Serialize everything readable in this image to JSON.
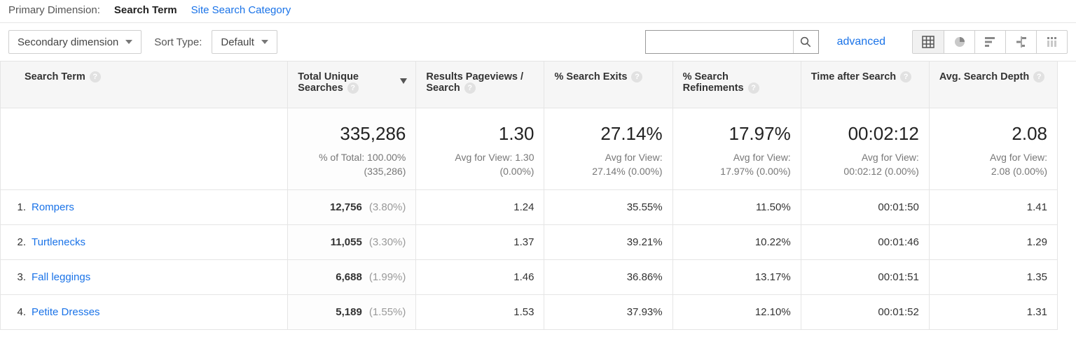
{
  "primary_dimension": {
    "label": "Primary Dimension:",
    "active": "Search Term",
    "other": "Site Search Category"
  },
  "toolbar": {
    "secondary_dimension": "Secondary dimension",
    "sort_type_label": "Sort Type:",
    "sort_type_value": "Default",
    "advanced": "advanced"
  },
  "columns": {
    "c0": "Search Term",
    "c1": "Total Unique Searches",
    "c2": "Results Pageviews / Search",
    "c3": "% Search Exits",
    "c4": "% Search Refinements",
    "c5": "Time after Search",
    "c6": "Avg. Search Depth"
  },
  "summary": {
    "c1": {
      "big": "335,286",
      "sub1": "% of Total: 100.00%",
      "sub2": "(335,286)"
    },
    "c2": {
      "big": "1.30",
      "sub1": "Avg for View: 1.30",
      "sub2": "(0.00%)"
    },
    "c3": {
      "big": "27.14%",
      "sub1": "Avg for View:",
      "sub2": "27.14% (0.00%)"
    },
    "c4": {
      "big": "17.97%",
      "sub1": "Avg for View:",
      "sub2": "17.97% (0.00%)"
    },
    "c5": {
      "big": "00:02:12",
      "sub1": "Avg for View:",
      "sub2": "00:02:12 (0.00%)"
    },
    "c6": {
      "big": "2.08",
      "sub1": "Avg for View:",
      "sub2": "2.08 (0.00%)"
    }
  },
  "rows": [
    {
      "n": "1.",
      "term": "Rompers",
      "unique": "12,756",
      "unique_pct": "(3.80%)",
      "rpv": "1.24",
      "exits": "35.55%",
      "refine": "11.50%",
      "time": "00:01:50",
      "depth": "1.41"
    },
    {
      "n": "2.",
      "term": "Turtlenecks",
      "unique": "11,055",
      "unique_pct": "(3.30%)",
      "rpv": "1.37",
      "exits": "39.21%",
      "refine": "10.22%",
      "time": "00:01:46",
      "depth": "1.29"
    },
    {
      "n": "3.",
      "term": "Fall leggings",
      "unique": "6,688",
      "unique_pct": "(1.99%)",
      "rpv": "1.46",
      "exits": "36.86%",
      "refine": "13.17%",
      "time": "00:01:51",
      "depth": "1.35"
    },
    {
      "n": "4.",
      "term": "Petite Dresses",
      "unique": "5,189",
      "unique_pct": "(1.55%)",
      "rpv": "1.53",
      "exits": "37.93%",
      "refine": "12.10%",
      "time": "00:01:52",
      "depth": "1.31"
    }
  ]
}
